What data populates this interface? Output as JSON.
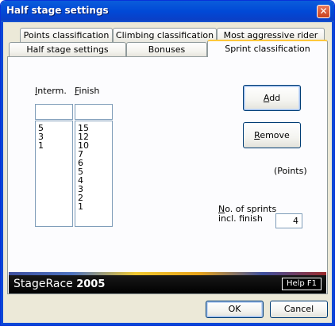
{
  "window": {
    "title": "Half stage settings",
    "close_glyph": "✕"
  },
  "tabs_back": [
    "Points classification",
    "Climbing classification",
    "Most aggressive rider"
  ],
  "tabs_front": [
    "Half stage settings",
    "Bonuses",
    "Sprint classification"
  ],
  "active_tab": "Sprint classification",
  "sprint": {
    "interm_label_u": "I",
    "interm_label_rest": "nterm.",
    "finish_label_u": "F",
    "finish_label_rest": "inish",
    "interm_values": [
      "5",
      "3",
      "1"
    ],
    "finish_values": [
      "15",
      "12",
      "10",
      "7",
      "6",
      "5",
      "4",
      "3",
      "2",
      "1"
    ],
    "add_u": "A",
    "add_rest": "dd",
    "remove_u": "R",
    "remove_rest": "emove",
    "points_label": "(Points)",
    "sprints_label_u": "N",
    "sprints_label_line1_rest": "o. of sprints",
    "sprints_label_line2": "incl. finish",
    "sprints_value": "4"
  },
  "banner": {
    "logo_text": "StageRace",
    "logo_year": "2005",
    "help_label": "Help F1"
  },
  "footer": {
    "ok_label": "OK",
    "cancel_label": "Cancel"
  }
}
